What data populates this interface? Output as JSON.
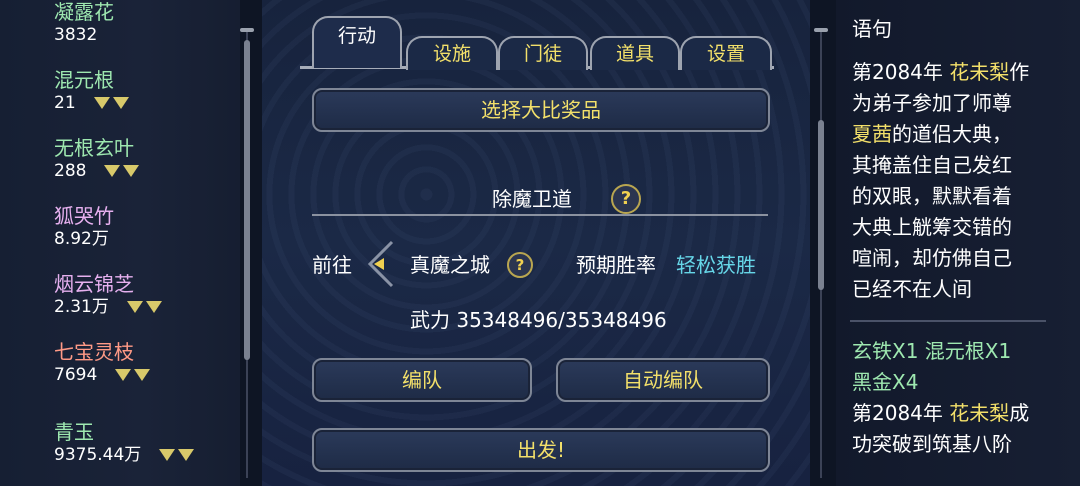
{
  "left_list": [
    {
      "name": "凝露花",
      "value": "3832",
      "arrows": 0,
      "color": "#9ee8b0"
    },
    {
      "name": "混元根",
      "value": "21",
      "arrows": 2,
      "color": "#9ee8b0"
    },
    {
      "name": "无根玄叶",
      "value": "288",
      "arrows": 2,
      "color": "#9ee8b0"
    },
    {
      "name": "狐哭竹",
      "value": "8.92万",
      "arrows": 0,
      "color": "#e6b0ef"
    },
    {
      "name": "烟云锦芝",
      "value": "2.31万",
      "arrows": 2,
      "color": "#e6b0ef"
    },
    {
      "name": "七宝灵枝",
      "value": "7694",
      "arrows": 2,
      "color": "#ff9a86"
    },
    {
      "name": "青玉",
      "value": "9375.44万",
      "arrows": 2,
      "color": "#9ee8b0"
    }
  ],
  "tabs": [
    {
      "label": "行动",
      "active": true
    },
    {
      "label": "设施",
      "active": false
    },
    {
      "label": "门徒",
      "active": false
    },
    {
      "label": "道具",
      "active": false
    },
    {
      "label": "设置",
      "active": false
    }
  ],
  "main": {
    "select_prize": "选择大比奖品",
    "section_title": "除魔卫道",
    "go_to": "前往",
    "location": "真魔之城",
    "win_rate_label": "预期胜率",
    "win_rate_value": "轻松获胜",
    "power": "武力 35348496/35348496",
    "formation": "编队",
    "auto_formation": "自动编队",
    "depart": "出发!"
  },
  "log": {
    "top_fragment": "语句",
    "entry1": {
      "year": "第2084年",
      "name": "花未梨",
      "t1": "作",
      "t2": "为弟子参加了师尊",
      "master": "夏茜",
      "t3": "的道侣大典，",
      "t4": "其掩盖住自己发红",
      "t5": "的双眼，默默看着",
      "t6": "大典上觥筹交错的",
      "t7": "喧闹，却仿佛自己",
      "t8": "已经不在人间"
    },
    "reward": {
      "i1": "玄铁X1",
      "i2": "混元根X1",
      "i3": "黑金X4"
    },
    "entry2": {
      "year": "第2084年",
      "name": "花未梨",
      "t1": "成",
      "t2": "功突破到筑基八阶"
    }
  },
  "colors": {
    "accent_yellow": "#f3e06a",
    "cyan": "#66d6e8",
    "green": "#9ee8b0"
  }
}
